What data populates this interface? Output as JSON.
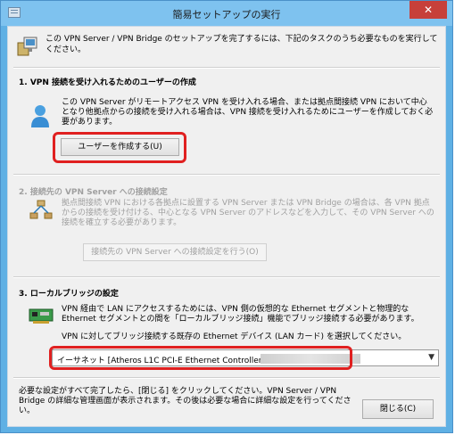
{
  "window": {
    "title": "簡易セットアップの実行",
    "close_glyph": "✕"
  },
  "intro": {
    "text": "この VPN Server / VPN Bridge のセットアップを完了するには、下記のタスクのうち必要なものを実行してください。"
  },
  "section1": {
    "title": "1. VPN 接続を受け入れるためのユーザーの作成",
    "desc": "この VPN Server がリモートアクセス VPN を受け入れる場合、または拠点間接続 VPN において中心となり他拠点からの接続を受け入れる場合は、VPN 接続を受け入れるためにユーザーを作成しておく必要があります。",
    "button_label": "ユーザーを作成する(U)"
  },
  "section2": {
    "title": "2. 接続先の VPN Server への接続設定",
    "desc": "拠点間接続 VPN における各拠点に設置する VPN Server または VPN Bridge の場合は、各 VPN 拠点からの接続を受け付ける、中心となる VPN Server のアドレスなどを入力して、その VPN Server への接続を確立する必要があります。",
    "button_label": "接続先の VPN Server への接続設定を行う(O)"
  },
  "section3": {
    "title": "3. ローカルブリッジの設定",
    "desc": "VPN 経由で LAN にアクセスするためには、VPN 側の仮想的な Ethernet セグメントと物理的な Ethernet セグメントとの間を「ローカルブリッジ接続」機能でブリッジ接続する必要があります。",
    "prompt": "VPN に対してブリッジ接続する既存の Ethernet デバイス (LAN カード) を選択してください。",
    "selected_device": "イーサネット [Atheros L1C PCI-E Ethernet Controller"
  },
  "footer": {
    "text": "必要な設定がすべて完了したら、[閉じる] をクリックしてください。VPN Server / VPN Bridge の詳細な管理画面が表示されます。その後は必要な場合に詳細な設定を行ってください。",
    "close_label": "閉じる(C)"
  },
  "colors": {
    "highlight": "#e02020",
    "titlebar": "#7ec2ef",
    "close": "#c7403a"
  }
}
